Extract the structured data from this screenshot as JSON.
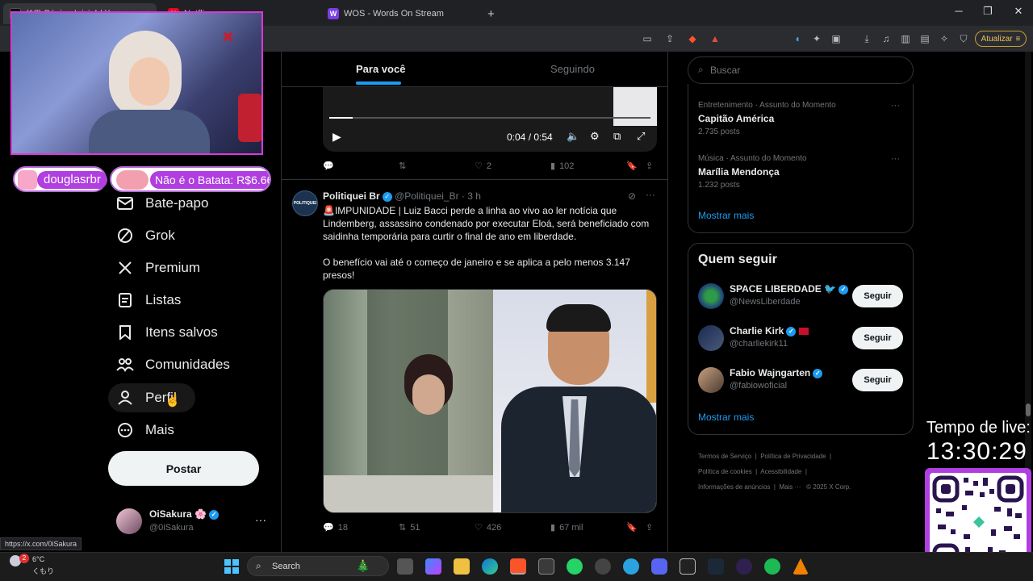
{
  "browser": {
    "tabs": [
      {
        "title": "(17) Página Inicial / X",
        "active": true
      },
      {
        "title": "Netflix",
        "active": false
      },
      {
        "title": "WOS - Words On Stream",
        "active": false
      }
    ],
    "new_tab_icon": "plus-icon",
    "update_label": "Atualizar",
    "status_url": "https://x.com/0iSakura"
  },
  "overlay": {
    "chat_user": "douglasrbr",
    "donation_text": "Não é o Batata: R$6.66",
    "live_time_label": "Tempo de live:",
    "live_time_value": "13:30:29"
  },
  "nav": {
    "items": [
      {
        "label": "Bate-papo",
        "icon": "mail-icon"
      },
      {
        "label": "Grok",
        "icon": "grok-icon"
      },
      {
        "label": "Premium",
        "icon": "x-logo-icon"
      },
      {
        "label": "Listas",
        "icon": "list-icon"
      },
      {
        "label": "Itens salvos",
        "icon": "bookmark-icon"
      },
      {
        "label": "Comunidades",
        "icon": "communities-icon"
      },
      {
        "label": "Perfil",
        "icon": "person-icon"
      },
      {
        "label": "Mais",
        "icon": "more-circle-icon"
      }
    ],
    "post_label": "Postar",
    "account": {
      "name": "OiSakura 🌸",
      "handle": "@0iSakura"
    }
  },
  "feed": {
    "tabs": [
      {
        "label": "Para você",
        "active": true
      },
      {
        "label": "Seguindo",
        "active": false
      }
    ],
    "video": {
      "time": "0:04 / 0:54",
      "progress": 0.074
    },
    "tweet1_stats": {
      "replies": "",
      "retweets": "",
      "likes": "2",
      "views": "102"
    },
    "tweet2": {
      "author": "Politiquei Br",
      "handle": "@Politiquei_Br",
      "time": "· 3 h",
      "text1": "🚨IMPUNIDADE | Luiz Bacci perde a linha ao vivo ao ler notícia que Lindemberg, assassino condenado por executar Eloá, será beneficiado com saidinha temporária para curtir o final de ano em liberdade.",
      "text2": "O benefício vai até o começo de janeiro e se aplica a pelo menos 3.147 presos!",
      "stats": {
        "replies": "18",
        "retweets": "51",
        "likes": "426",
        "views": "67 mil"
      }
    }
  },
  "sidebar": {
    "search_placeholder": "Buscar",
    "trends": [
      {
        "category": "Entretenimento · Assunto do Momento",
        "title": "Capitão América",
        "posts": "2.735 posts"
      },
      {
        "category": "Música · Assunto do Momento",
        "title": "Marília Mendonça",
        "posts": "1.232 posts"
      }
    ],
    "show_more": "Mostrar mais",
    "who_to_follow_title": "Quem seguir",
    "who_to_follow": [
      {
        "name": "SPACE LIBERDADE",
        "handle": "@NewsLiberdade"
      },
      {
        "name": "Charlie Kirk",
        "handle": "@charliekirk11"
      },
      {
        "name": "Fabio Wajngarten",
        "handle": "@fabiowoficial"
      }
    ],
    "follow_label": "Seguir",
    "show_more2": "Mostrar mais",
    "footer": [
      "Termos de Serviço",
      "Política de Privacidade",
      "Política de cookies",
      "Acessibilidade",
      "Informações de anúncios",
      "Mais ···",
      "© 2025 X Corp."
    ]
  },
  "taskbar": {
    "weather_temp": "6°C",
    "weather_desc": "くもり",
    "search_label": "Search"
  },
  "colors": {
    "accent": "#1d9bf0",
    "bg": "#000000",
    "border": "#2f3336"
  }
}
